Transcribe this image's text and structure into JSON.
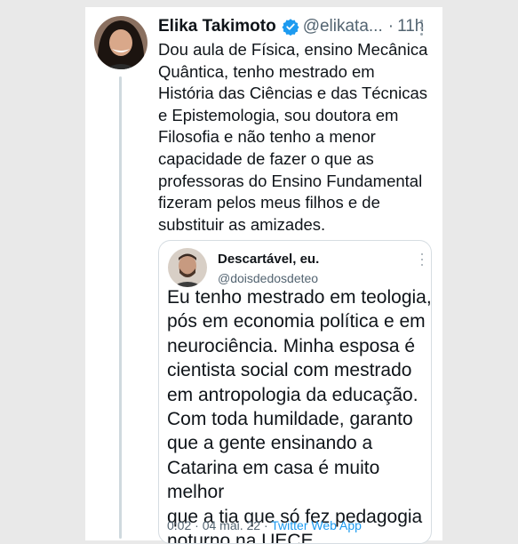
{
  "tweet": {
    "author_name": "Elika Takimoto",
    "handle": "@elikata...",
    "separator": "·",
    "time": "11h",
    "body": "Dou aula de Física, ensino Mecânica\nQuântica, tenho mestrado em\nHistória das Ciências e das Técnicas\ne Epistemologia, sou doutora em\nFilosofia e não tenho a menor\ncapacidade de fazer o que as\nprofessoras do Ensino Fundamental\nfizeram pelos meus filhos e de\nsubstituir as amizades."
  },
  "quoted_tweet": {
    "author_name": "Descartável, eu.",
    "handle": "@doisdedosdeteo",
    "body": "Eu tenho mestrado em teologia,\npós em economia política e em\nneurociência. Minha esposa é\ncientista social com mestrado\nem antropologia da educação.\nCom toda humildade, garanto\nque a gente ensinando a\nCatarina em casa é muito melhor\nque a tia que só fez pedagogia\nnoturno na UECE.",
    "timestamp": "0:02 · 04 mai. 22 ·",
    "source": "Twitter Web App"
  },
  "icons": {
    "verified": "verified-badge-icon",
    "more": "more-options-icon"
  },
  "colors": {
    "verified_blue": "#1d9bf0",
    "source_link": "#1d9bf0",
    "secondary_text": "#536471",
    "thread_line": "#cfd9de"
  }
}
